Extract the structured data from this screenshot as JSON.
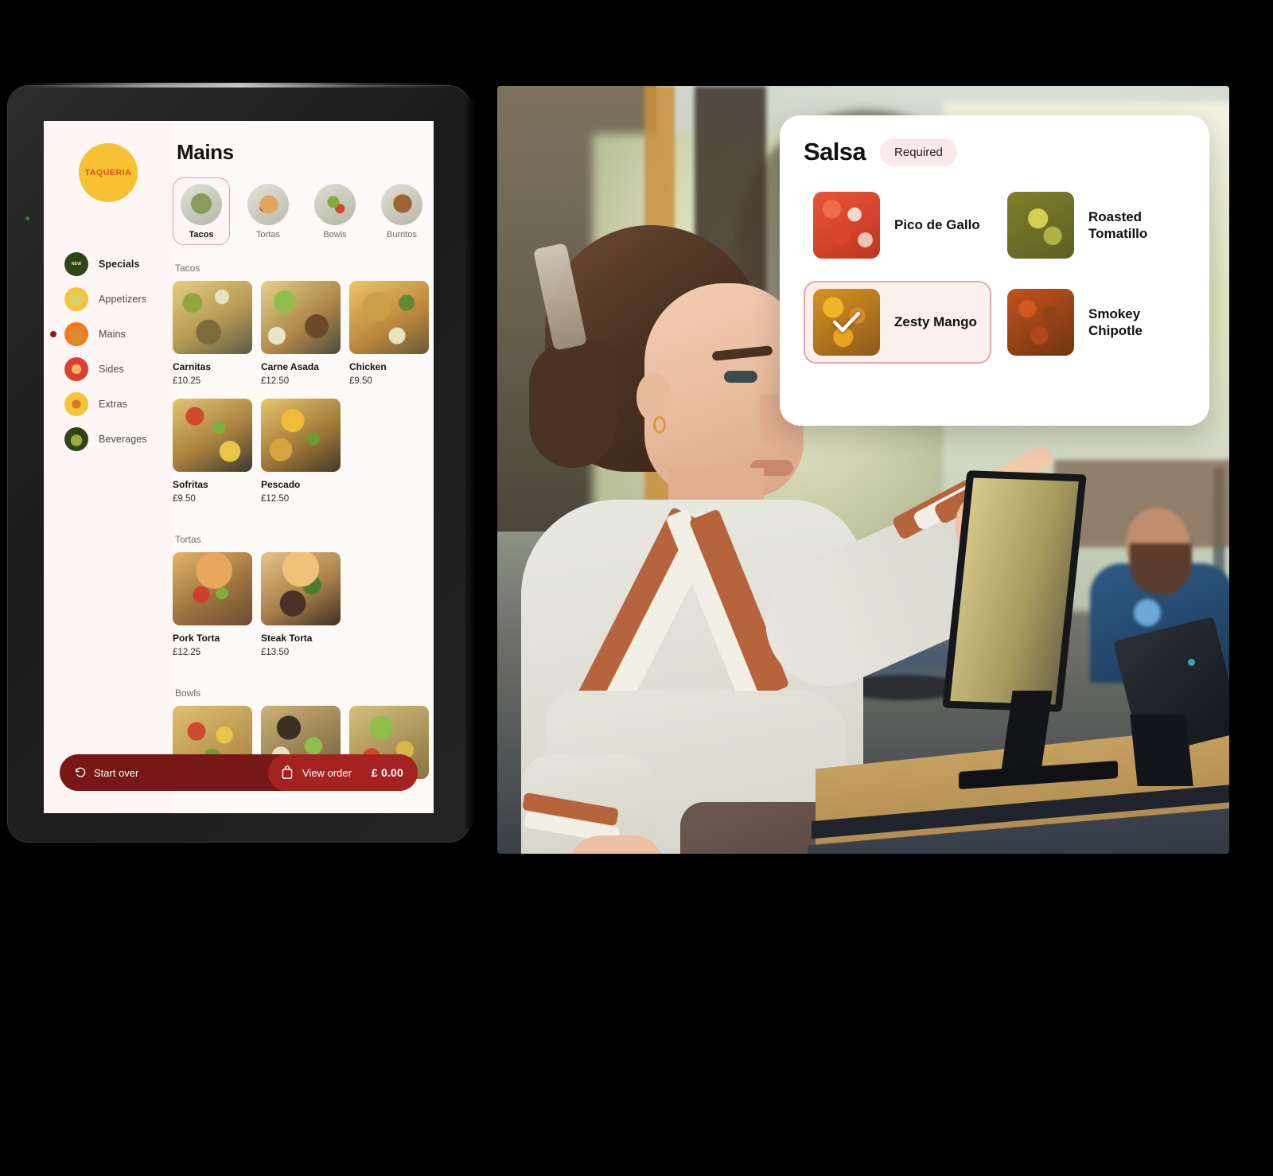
{
  "kiosk": {
    "logo_text": "TAQUERIA",
    "page_title": "Mains",
    "sidebar_items": [
      {
        "label": "Specials",
        "icon": "new-badge-icon",
        "active": false,
        "bold": true
      },
      {
        "label": "Appetizers",
        "icon": "avocado-icon",
        "active": false,
        "bold": false
      },
      {
        "label": "Mains",
        "icon": "taco-icon",
        "active": true,
        "bold": false
      },
      {
        "label": "Sides",
        "icon": "corn-icon",
        "active": false,
        "bold": false
      },
      {
        "label": "Extras",
        "icon": "chili-icon",
        "active": false,
        "bold": false
      },
      {
        "label": "Beverages",
        "icon": "bottle-icon",
        "active": false,
        "bold": false
      }
    ],
    "tabs": [
      {
        "label": "Tacos",
        "thumb": "t-tacos",
        "active": true
      },
      {
        "label": "Tortas",
        "thumb": "t-tortas",
        "active": false
      },
      {
        "label": "Bowls",
        "thumb": "t-bowls",
        "active": false
      },
      {
        "label": "Burritos",
        "thumb": "t-burritos",
        "active": false
      }
    ],
    "sections": [
      {
        "heading": "Tacos",
        "items": [
          {
            "name": "Carnitas",
            "price": "£10.25",
            "thumb": "f-carnitas"
          },
          {
            "name": "Carne Asada",
            "price": "£12.50",
            "thumb": "f-asada"
          },
          {
            "name": "Chicken",
            "price": "£9.50",
            "thumb": "f-chicken"
          },
          {
            "name": "Sofritas",
            "price": "£9.50",
            "thumb": "f-sofritas"
          },
          {
            "name": "Pescado",
            "price": "£12.50",
            "thumb": "f-pescado"
          }
        ]
      },
      {
        "heading": "Tortas",
        "items": [
          {
            "name": "Pork Torta",
            "price": "£12.25",
            "thumb": "f-porktorta"
          },
          {
            "name": "Steak Torta",
            "price": "£13.50",
            "thumb": "f-steaktorta"
          }
        ]
      },
      {
        "heading": "Bowls",
        "items": [
          {
            "name": "",
            "price": "",
            "thumb": "f-bowl1"
          },
          {
            "name": "",
            "price": "",
            "thumb": "f-bowl2"
          },
          {
            "name": "",
            "price": "",
            "thumb": "f-bowl3"
          }
        ]
      }
    ],
    "bottom_bar": {
      "start_over_label": "Start over",
      "start_over_icon": "undo-arrow-icon",
      "view_order_label": "View order",
      "view_order_icon": "shopping-bag-icon",
      "order_total": "£ 0.00"
    }
  },
  "salsa_panel": {
    "title": "Salsa",
    "required_badge": "Required",
    "options": [
      {
        "label": "Pico de Gallo",
        "thumb": "s-pico",
        "selected": false
      },
      {
        "label": "Roasted Tomatillo",
        "thumb": "s-tomatillo",
        "selected": false
      },
      {
        "label": "Zesty Mango",
        "thumb": "s-mango",
        "selected": true
      },
      {
        "label": "Smokey Chipotle",
        "thumb": "s-chipotle",
        "selected": false
      }
    ],
    "check_icon": "check-icon"
  },
  "colors": {
    "brand_yellow": "#f6c132",
    "brand_red": "#8f1a1a",
    "bar_dark_red": "#781717",
    "bar_light_red": "#a62222",
    "accent_pink_border": "#e4a8ab",
    "badge_pink_bg": "#fae9ea",
    "screen_bg": "#fdf9f7",
    "page_bg": "#000000"
  }
}
